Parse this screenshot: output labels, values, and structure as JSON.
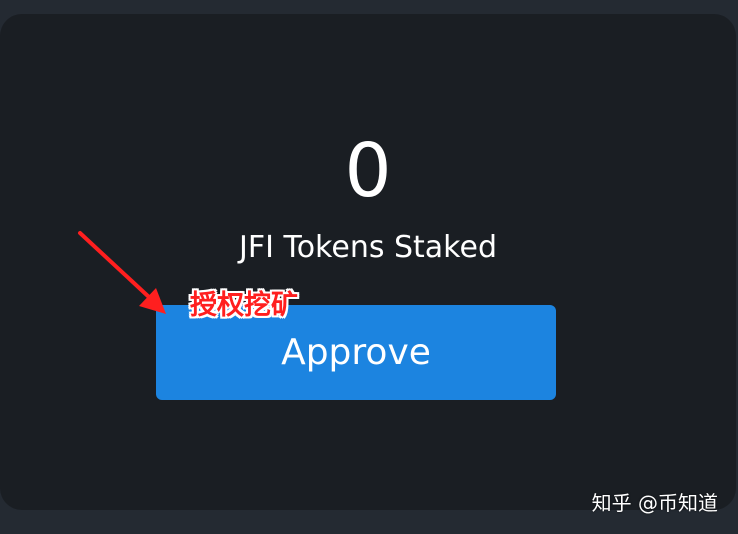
{
  "stake_panel": {
    "staked_amount": "0",
    "staked_label": "JFI Tokens Staked",
    "approve_label": "Approve"
  },
  "annotation": {
    "text": "授权挖矿",
    "color": "#ff1f1f"
  },
  "watermark": {
    "text": "知乎 @币知道"
  },
  "colors": {
    "background": "#242a32",
    "card": "#1a1e23",
    "button": "#1c84e0",
    "text": "#ffffff"
  }
}
